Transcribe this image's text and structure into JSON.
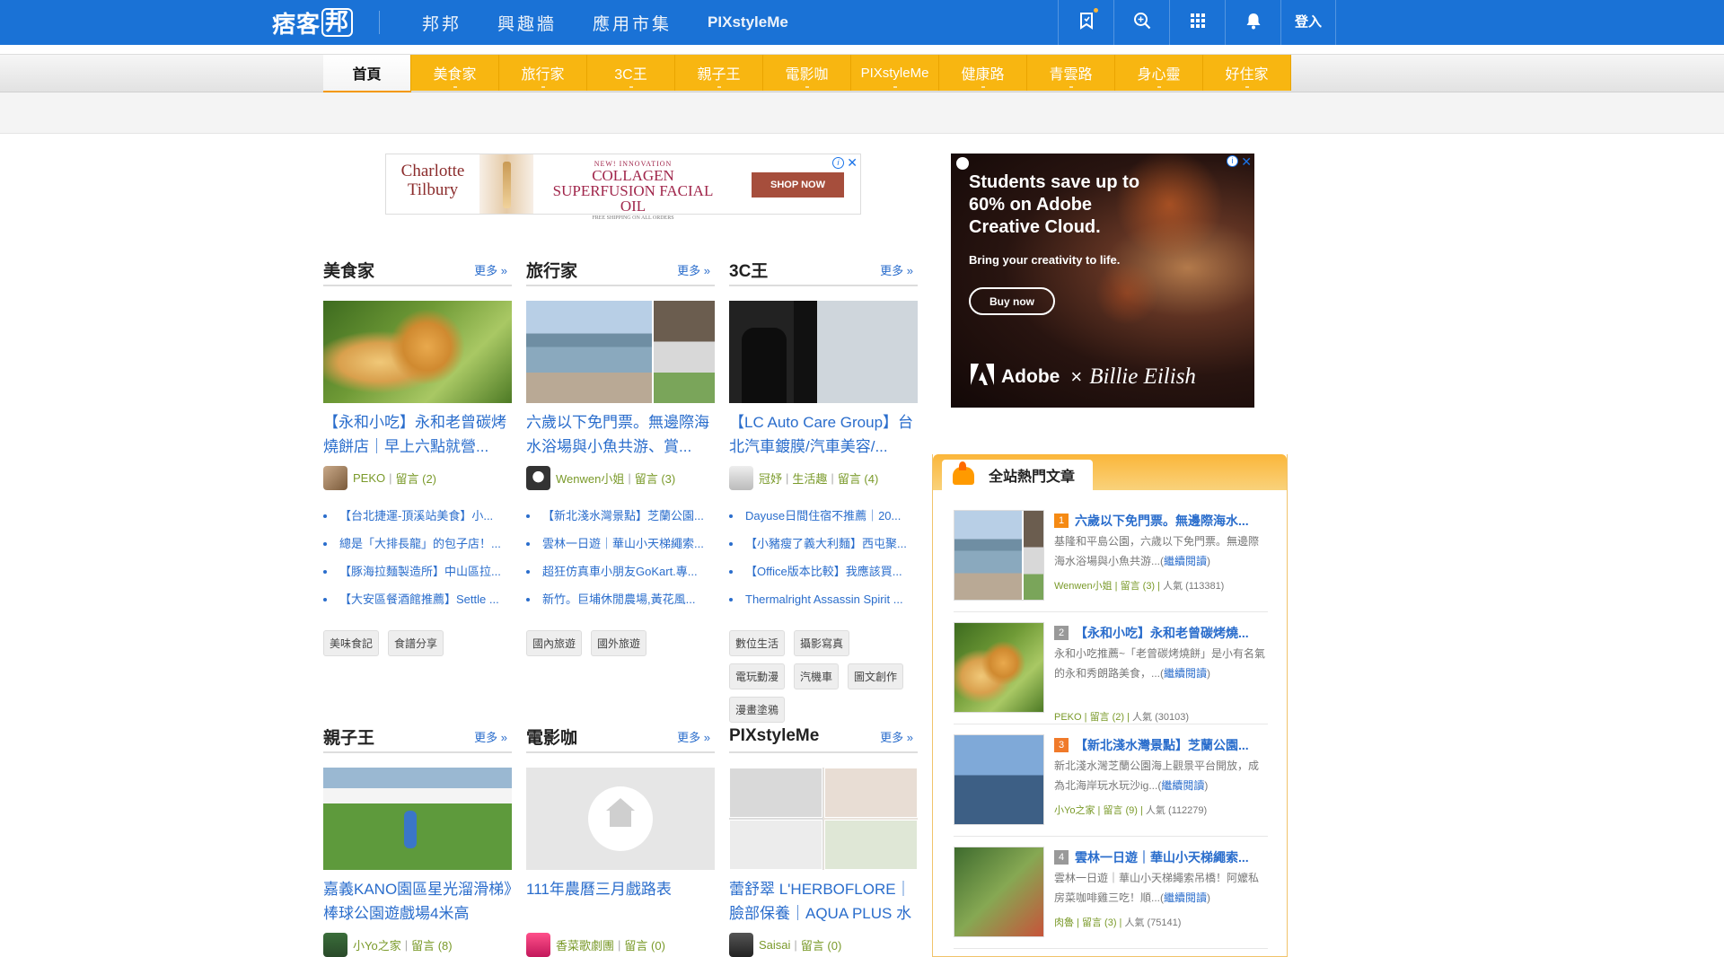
{
  "topbar": {
    "logo_a": "痞客",
    "logo_b": "邦",
    "nav": [
      "邦邦",
      "興趣牆",
      "應用市集",
      "PIXstyleMe"
    ],
    "login": "登入"
  },
  "channels": [
    "首頁",
    "美食家",
    "旅行家",
    "3C王",
    "親子王",
    "電影咖",
    "PIXstyleMe",
    "健康路",
    "青雲路",
    "身心靈",
    "好住家"
  ],
  "ad_banner": {
    "brand": "Charlotte Tilbury",
    "line1": "NEW! INNOVATION",
    "line2": "COLLAGEN SUPERFUSION FACIAL OIL",
    "line3": "FREE SHIPPING ON ALL ORDERS",
    "cta": "SHOP NOW"
  },
  "ad_side": {
    "headline": "Students save up to 60% on Adobe Creative Cloud.",
    "sub": "Bring your creativity to life.",
    "cta": "Buy now",
    "brand": "Adobe",
    "x": "×",
    "partner": "Billie Eilish"
  },
  "more_label": "更多 »",
  "categories_row1": [
    {
      "title": "美食家",
      "article": "【永和小吃】永和老曾碳烤燒餅店｜早上六點就營...",
      "author": "PEKO",
      "comments": "留言 (2)",
      "list": [
        "【台北捷運-頂溪站美食】小...",
        "總是「大排長龍」的包子店！...",
        "【豚海拉麵製造所】中山區拉...",
        "【大安區餐酒館推薦】Settle ..."
      ],
      "tags": [
        "美味食記",
        "食譜分享"
      ]
    },
    {
      "title": "旅行家",
      "article": "六歲以下免門票。無邊際海水浴場與小魚共游、賞...",
      "author": "Wenwen小姐",
      "comments": "留言 (3)",
      "list": [
        "【新北淺水灣景點】芝蘭公園...",
        "雲林一日遊｜華山小天梯繩索...",
        "超狂仿真車小朋友GoKart.專...",
        "新竹。巨埔休閒農場,黃花風..."
      ],
      "tags": [
        "國內旅遊",
        "國外旅遊"
      ]
    },
    {
      "title": "3C王",
      "article": "【LC Auto Care Group】台北汽車鍍膜/汽車美容/...",
      "author": "冠妤",
      "subcat": "生活趣",
      "comments": "留言 (4)",
      "list": [
        "Dayuse日間住宿不推薦｜20...",
        "【小豬瘦了義大利麵】西屯聚...",
        "【Office版本比較】我應該買...",
        "Thermalright Assassin Spirit ..."
      ],
      "tags": [
        "數位生活",
        "攝影寫真",
        "電玩動漫",
        "汽機車",
        "圖文創作",
        "漫畫塗鴉"
      ]
    }
  ],
  "categories_row2": [
    {
      "title": "親子王",
      "article": "嘉義KANO園區星光溜滑梯》棒球公園遊戲場4米高",
      "author": "小Yo之家",
      "comments": "留言 (8)"
    },
    {
      "title": "電影咖",
      "article": "111年農曆三月戲路表",
      "author": "香菜歌劇團",
      "comments": "留言 (0)"
    },
    {
      "title": "PIXstyleMe",
      "article": "蕾舒翠 L'HERBOFLORE｜臉部保養｜AQUA PLUS 水",
      "author": "Saisai",
      "comments": "留言 (0)"
    }
  ],
  "hot": {
    "title": "全站熱門文章",
    "read_more": "繼續閱讀",
    "items": [
      {
        "rank": "1",
        "title": "六歲以下免門票。無邊際海水...",
        "desc": "基隆和平島公園，六歲以下免門票。無邊際海水浴場與小魚共游...",
        "author": "Wenwen小姐",
        "comments": "留言 (3)",
        "pop": "人氣 (113381)"
      },
      {
        "rank": "2",
        "title": "【永和小吃】永和老曾碳烤燒...",
        "desc": "永和小吃推薦~「老曾碳烤燒餅」是小有名氣的永和秀朗路美食，...",
        "author": "PEKO",
        "comments": "留言 (2)",
        "pop": "人氣 (30103)"
      },
      {
        "rank": "3",
        "title": "【新北淺水灣景點】芝蘭公園...",
        "desc": "新北淺水灣芝蘭公園海上觀景平台開放，成為北海岸玩水玩沙ig...",
        "author": "小Yo之家",
        "comments": "留言 (9)",
        "pop": "人氣 (112279)"
      },
      {
        "rank": "4",
        "title": "雲林一日遊｜華山小天梯繩索...",
        "desc": "雲林一日遊｜華山小天梯繩索吊橋！阿嬤私房菜咖啡雞三吃！順...",
        "author": "肉魯",
        "comments": "留言 (3)",
        "pop": "人氣 (75141)"
      }
    ]
  }
}
